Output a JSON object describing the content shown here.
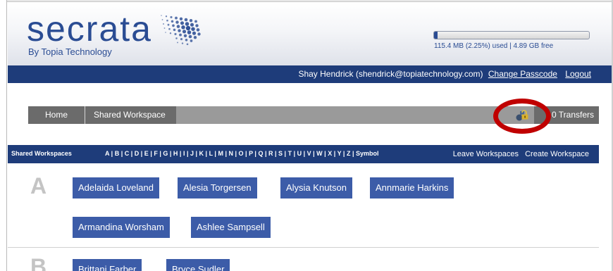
{
  "header": {
    "logo_text": "secrata",
    "logo_sub": "By Topia Technology",
    "storage_used_fraction": 0.0225,
    "storage_text": "115.4 MB (2.25%) used | 4.89 GB free"
  },
  "userbar": {
    "user": "Shay Hendrick (shendrick@topiatechnology.com)",
    "change_passcode": "Change Passcode",
    "logout": "Logout"
  },
  "nav": {
    "home": "Home",
    "shared_workspace": "Shared Workspace",
    "transfers": "0 Transfers",
    "icon": "lock-transfer-icon"
  },
  "alphabar": {
    "label": "Shared Workspaces",
    "letters": [
      "A",
      "B",
      "C",
      "D",
      "E",
      "F",
      "G",
      "H",
      "I",
      "J",
      "K",
      "L",
      "M",
      "N",
      "O",
      "P",
      "Q",
      "R",
      "S",
      "T",
      "U",
      "V",
      "W",
      "X",
      "Y",
      "Z",
      "Symbol"
    ],
    "leave": "Leave Workspaces",
    "create": "Create Workspace"
  },
  "groups": [
    {
      "letter": "A",
      "items": [
        "Adelaida Loveland",
        "Alesia Torgersen",
        "Alysia Knutson",
        "Annmarie Harkins",
        "Armandina Worsham",
        "Ashlee Sampsell"
      ]
    },
    {
      "letter": "B",
      "items": [
        "Brittani Farber",
        "Bryce Sudler"
      ]
    }
  ],
  "colors": {
    "brand_blue": "#2a4c93",
    "bar_navy": "#1e3c7a",
    "button_blue": "#3c5ca8",
    "highlight_red": "#c00000"
  }
}
